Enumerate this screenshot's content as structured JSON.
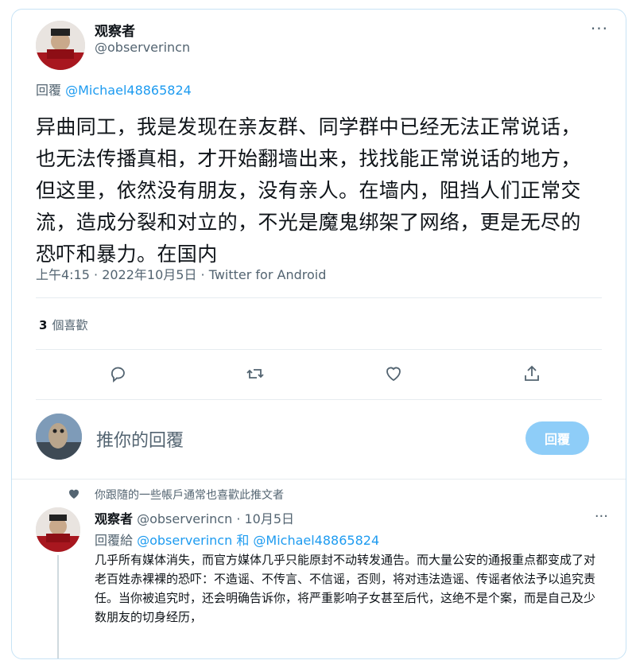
{
  "tweet": {
    "display_name": "观察者",
    "handle": "@observerincn",
    "more_label": "···",
    "reply_prefix": "回覆",
    "reply_mention": "@Michael48865824",
    "text": "异曲同工，我是发现在亲友群、同学群中已经无法正常说话，也无法传播真相，才开始翻墙出来，找找能正常说话的地方，但这里，依然没有朋友，没有亲人。在墙内，阻挡人们正常交流，造成分裂和对立的，不光是魔鬼绑架了网络，更是无尽的恐吓和暴力。在国内",
    "meta": "上午4:15 · 2022年10月5日 · Twitter for Android",
    "likes_count": "3",
    "likes_label": "個喜歡",
    "icons": [
      "reply-icon",
      "retweet-icon",
      "like-icon",
      "share-icon"
    ]
  },
  "compose": {
    "placeholder": "推你的回覆",
    "button": "回覆"
  },
  "reply": {
    "social_context": "你跟隨的一些帳戶通常也喜歡此推文者",
    "display_name": "观察者",
    "handle_time": "@observerincn · 10月5日",
    "more_label": "···",
    "reply_prefix": "回覆給",
    "reply_mentions": "@observerincn 和 @Michael48865824",
    "text": "几乎所有媒体消失，而官方媒体几乎只能原封不动转发通告。而大量公安的通报重点都变成了对老百姓赤裸裸的恐吓：不造谣、不传言、不信谣，否则，将对违法造谣、传谣者依法予以追究责任。当你被追究时，还会明确告诉你，将严重影响子女甚至后代，这绝不是个案，而是自己及少数朋友的切身经历，"
  },
  "colors": {
    "accent": "#1d9bf0",
    "secondary_text": "#536471",
    "reply_button": "#8ecdf8"
  }
}
